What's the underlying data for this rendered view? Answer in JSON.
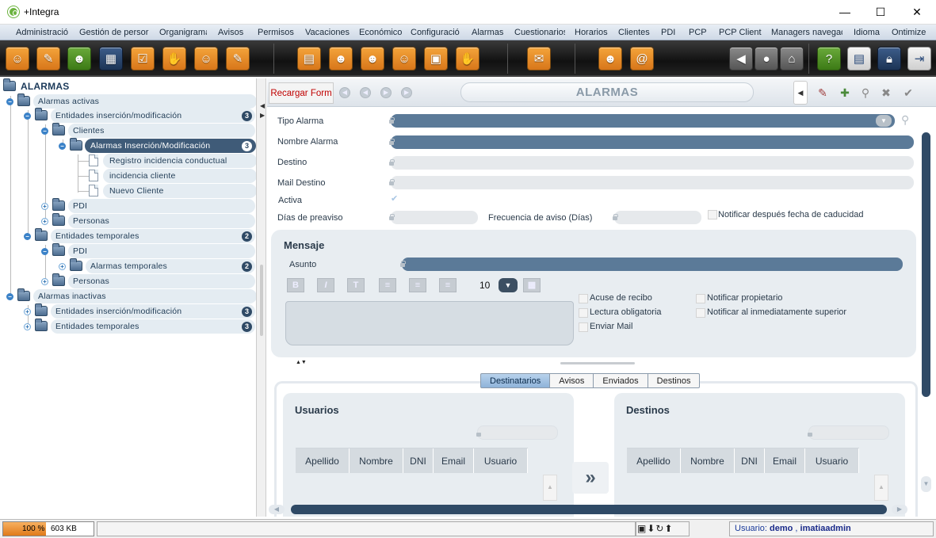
{
  "window": {
    "title": "+Integra",
    "minimize": "—",
    "maximize": "☐",
    "close": "✕"
  },
  "menu": [
    "Administració",
    "Gestión de persor",
    "Organigrama",
    "Avisos",
    "Permisos",
    "Vacaciones",
    "Económico",
    "Configuració",
    "Alarmas",
    "Cuestionarios",
    "Horarios",
    "Clientes",
    "PDI",
    "PCP",
    "PCP Cliente",
    "Managers navegac",
    "Idioma",
    "Ontimize"
  ],
  "toolbar_icons": [
    "employees-icon",
    "tasks-icon",
    "person-icon",
    "schedule-icon",
    "checklist-icon",
    "handshake-icon",
    "group-icon",
    "notes-icon",
    "calendar-icon",
    "user-green-icon",
    "manager-icon",
    "team-icon",
    "presentation-icon",
    "agreement-icon",
    "mail-icon",
    "user-profile-icon",
    "at-icon",
    "back-icon",
    "stop-icon",
    "home-icon",
    "help-icon",
    "dashboard-icon",
    "lock-icon",
    "exit-icon"
  ],
  "tree": {
    "root": "ALARMAS",
    "nodes": [
      {
        "label": "Alarmas activas"
      },
      {
        "label": "Entidades inserción/modificación",
        "count": "3"
      },
      {
        "label": "Clientes"
      },
      {
        "label": "Alarmas Inserción/Modificación",
        "count": "3"
      },
      {
        "label": "Registro incidencia conductual"
      },
      {
        "label": "incidencia cliente"
      },
      {
        "label": "Nuevo Cliente"
      },
      {
        "label": "PDI"
      },
      {
        "label": "Personas"
      },
      {
        "label": "Entidades temporales",
        "count": "2"
      },
      {
        "label": "PDI"
      },
      {
        "label": "Alarmas temporales",
        "count": "2"
      },
      {
        "label": "Personas"
      },
      {
        "label": "Alarmas inactivas"
      },
      {
        "label": "Entidades inserción/modificación",
        "count": "3"
      },
      {
        "label": "Entidades temporales",
        "count": "3"
      }
    ]
  },
  "form": {
    "reload": "Recargar Form",
    "title": "ALARMAS",
    "fields": {
      "tipo_alarma": {
        "label": "Tipo Alarma",
        "value": ""
      },
      "nombre_alarma": {
        "label": "Nombre Alarma",
        "value": ""
      },
      "destino": {
        "label": "Destino",
        "value": ""
      },
      "mail_destino": {
        "label": "Mail Destino",
        "value": ""
      },
      "activa": {
        "label": "Activa",
        "checked": true
      },
      "dias_preaviso": {
        "label": "Días de preaviso",
        "value": ""
      },
      "frecuencia": {
        "label": "Frecuencia de aviso (Días)",
        "value": ""
      },
      "notificar_caducidad": {
        "label": "Notificar después fecha de caducidad",
        "checked": false
      }
    },
    "mensaje": {
      "title": "Mensaje",
      "asunto_label": "Asunto",
      "asunto_value": "",
      "font_size": "10",
      "format_buttons": [
        "B",
        "I",
        "T"
      ],
      "options": [
        {
          "label": "Acuse de recibo",
          "checked": false
        },
        {
          "label": "Lectura obligatoria",
          "checked": false
        },
        {
          "label": "Enviar Mail",
          "checked": false
        },
        {
          "label": "Notificar propietario",
          "checked": false
        },
        {
          "label": "Notificar al inmediatamente superior",
          "checked": false
        }
      ]
    },
    "tabs": [
      "Destinatarios",
      "Avisos",
      "Enviados",
      "Destinos"
    ],
    "active_tab": "Destinatarios",
    "usuarios": {
      "title": "Usuarios",
      "columns": [
        "Apellido",
        "Nombre",
        "DNI",
        "Email",
        "Usuario"
      ]
    },
    "destinos": {
      "title": "Destinos",
      "columns": [
        "Apellido",
        "Nombre",
        "DNI",
        "Email",
        "Usuario"
      ]
    },
    "move_arrow": "»"
  },
  "status": {
    "memory_pct": "100 %",
    "memory_kb": "603 KB",
    "user_prefix": "Usuario: ",
    "user": "demo",
    "user_sep": " , ",
    "admin": "imatiaadmin"
  },
  "colors": {
    "accent_dark": "#2f4a66",
    "field_dark": "#5b7a98",
    "reload_text": "#c00000",
    "memory_bar": "#e07a1a"
  }
}
